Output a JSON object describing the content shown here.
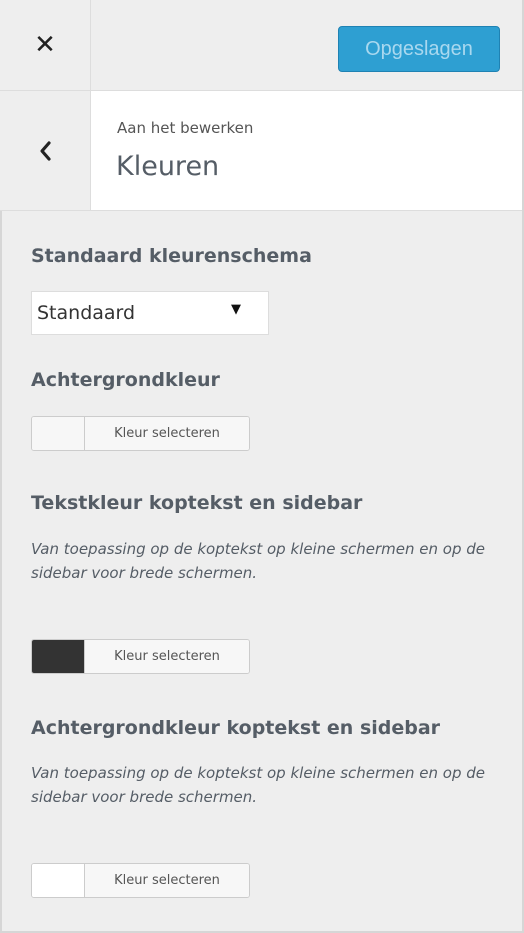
{
  "header": {
    "close_icon": "close-icon",
    "save_label": "Opgeslagen"
  },
  "section": {
    "back_icon": "chevron-left-icon",
    "subtitle": "Aan het bewerken",
    "title": "Kleuren"
  },
  "controls": {
    "scheme": {
      "title": "Standaard kleurenschema",
      "selected": "Standaard",
      "arrow": "▼"
    },
    "background": {
      "title": "Achtergrondkleur",
      "button_label": "Kleur selecteren",
      "swatch_color": "#f7f7f7"
    },
    "header_text": {
      "title": "Tekstkleur koptekst en sidebar",
      "description": "Van toepassing op de koptekst op kleine schermen en op de sidebar voor brede schermen.",
      "button_label": "Kleur selecteren",
      "swatch_color": "#333333"
    },
    "header_bg": {
      "title": "Achtergrondkleur koptekst en sidebar",
      "description": "Van toepassing op de koptekst op kleine schermen en op de sidebar voor brede schermen.",
      "button_label": "Kleur selecteren",
      "swatch_color": "#ffffff"
    }
  },
  "colors": {
    "accent": "#2e9fd2",
    "panel_bg": "#eeeeee"
  }
}
